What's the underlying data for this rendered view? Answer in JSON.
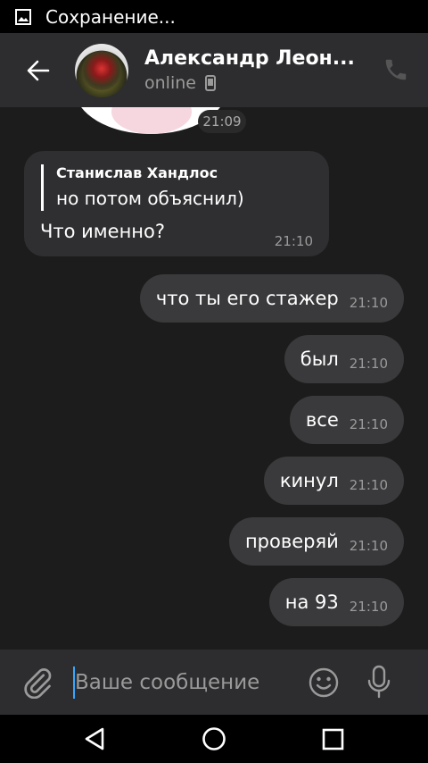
{
  "status_bar": {
    "text": "Сохранение..."
  },
  "header": {
    "title": "Александр Леон...",
    "subtitle": "online"
  },
  "chat": {
    "sticker_time": "21:09",
    "incoming": {
      "reply_name": "Станислав Хандлос",
      "reply_text": "но потом объяснил)",
      "text": "Что именно?",
      "time": "21:10"
    },
    "outgoing": [
      {
        "text": "что ты его стажер",
        "time": "21:10"
      },
      {
        "text": "был",
        "time": "21:10"
      },
      {
        "text": "все",
        "time": "21:10"
      },
      {
        "text": "кинул",
        "time": "21:10"
      },
      {
        "text": "проверяй",
        "time": "21:10"
      },
      {
        "text": "на 93",
        "time": "21:10"
      }
    ]
  },
  "composer": {
    "placeholder": "Ваше сообщение"
  },
  "colors": {
    "background": "#1c1c1c",
    "header": "#2d2d2f",
    "bubble_out": "#3a3a3c",
    "bubble_in": "#2f2f31",
    "caret": "#3aa7ff"
  },
  "icons": [
    "image-icon",
    "back-arrow-icon",
    "chevron-down-icon",
    "phone-device-icon",
    "call-icon",
    "paperclip-icon",
    "emoji-icon",
    "microphone-icon",
    "nav-back-icon",
    "nav-home-icon",
    "nav-recents-icon"
  ]
}
